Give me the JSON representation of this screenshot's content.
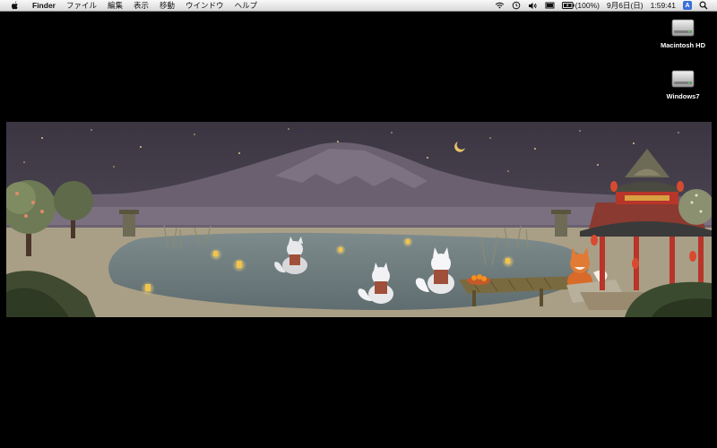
{
  "menubar": {
    "app_name": "Finder",
    "items": [
      "ファイル",
      "編集",
      "表示",
      "移動",
      "ウインドウ",
      "ヘルプ"
    ],
    "status": {
      "battery_text": "(100%)",
      "date_text": "9月6日(日)",
      "time_text": "1:59:41",
      "input_method": "A"
    }
  },
  "desktop": {
    "icons": [
      {
        "label": "Macintosh HD",
        "icon": "hard-drive-icon"
      },
      {
        "label": "Windows7",
        "icon": "hard-drive-icon"
      }
    ]
  },
  "wallpaper": {
    "icon": "wallpaper-image",
    "colors": {
      "sky": "#4a4250",
      "mountain": "#6a6070",
      "water": "#7c8a8c",
      "pavilion": "#b8352a"
    }
  }
}
